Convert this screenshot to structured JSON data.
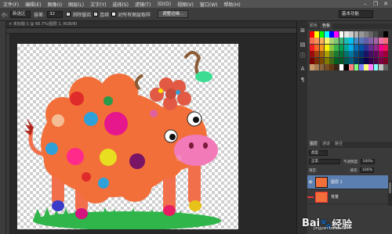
{
  "menu": {
    "items": [
      "文件(F)",
      "编辑(E)",
      "图像(I)",
      "图层(L)",
      "文字(Y)",
      "选择(S)",
      "滤镜(T)",
      "3D(D)",
      "视图(V)",
      "窗口(W)",
      "帮助(H)"
    ]
  },
  "options": {
    "size_label": "小:",
    "mode_value": "新选区",
    "feather_label": "容差:",
    "feather_value": "32",
    "antialias_label": "消除锯齿",
    "contiguous_label": "连续",
    "sample_all_label": "对所有图层取样",
    "refine_button": "调整边缘...",
    "workspace": "基本功能"
  },
  "document": {
    "tab_label": "× 未标题-1 @ 66.7%(图层 1, RGB/8)"
  },
  "panels": {
    "swatch_tabs": [
      "颜色",
      "色板"
    ],
    "layers_tabs": [
      "图层",
      "通道",
      "路径"
    ],
    "kind_label": "类型",
    "blend_mode": "正常",
    "opacity_label": "不透明度:",
    "opacity_value": "100%",
    "lock_label": "锁定:",
    "fill_label": "填充:",
    "fill_value": "100%",
    "layers": [
      {
        "name": "图层 1"
      },
      {
        "name": "背景"
      }
    ]
  },
  "swatch_colors": [
    "#ff0000",
    "#ffff00",
    "#00ff00",
    "#00ffff",
    "#0000ff",
    "#ff00ff",
    "#ffffff",
    "#e6e6e6",
    "#cccccc",
    "#b3b3b3",
    "#999999",
    "#808080",
    "#666666",
    "#4d4d4d",
    "#333333",
    "#000000",
    "#f26c4f",
    "#f68e56",
    "#fbaf5d",
    "#fff568",
    "#acd372",
    "#7cc576",
    "#3bb878",
    "#1abbb4",
    "#00bff3",
    "#438cca",
    "#5574b9",
    "#605ca8",
    "#855fa8",
    "#a763a8",
    "#f06eaa",
    "#f26d7d",
    "#ed1c24",
    "#f26522",
    "#f7941d",
    "#fff200",
    "#8dc73f",
    "#39b54a",
    "#00a651",
    "#00a99d",
    "#00aeef",
    "#0072bc",
    "#0054a6",
    "#2e3192",
    "#662d91",
    "#92278f",
    "#ec008c",
    "#ed145b",
    "#9e0b0f",
    "#a0410d",
    "#a36209",
    "#aba000",
    "#598527",
    "#1a7b30",
    "#007236",
    "#00746b",
    "#0076a3",
    "#004b80",
    "#003471",
    "#1b1464",
    "#440e62",
    "#630460",
    "#9e005d",
    "#9e0039",
    "#790000",
    "#7b2e00",
    "#7d4900",
    "#827b00",
    "#406618",
    "#005e20",
    "#005826",
    "#005952",
    "#005b7f",
    "#003663",
    "#002157",
    "#0d004c",
    "#32004b",
    "#4b0049",
    "#7b0046",
    "#7a0026",
    "#c69c6d",
    "#a67c52",
    "#8c6239",
    "#754c24",
    "#603913",
    "#3c2415",
    "#ffffff",
    "#000000",
    "#ff8080",
    "#80ff80",
    "#8080ff",
    "#ffff80",
    "#ff80ff",
    "#80ffff",
    "#c0c0c0",
    "#606060"
  ]
}
